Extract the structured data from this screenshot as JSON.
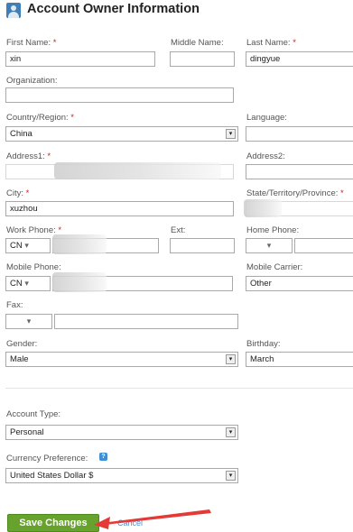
{
  "header": {
    "title": "Account Owner Information",
    "icon": "user-icon"
  },
  "fields": {
    "first_name": {
      "label": "First Name:",
      "required": "*",
      "value": "xin"
    },
    "middle_name": {
      "label": "Middle Name:",
      "value": ""
    },
    "last_name": {
      "label": "Last Name:",
      "required": "*",
      "value": "dingyue"
    },
    "organization": {
      "label": "Organization:",
      "value": ""
    },
    "country": {
      "label": "Country/Region:",
      "required": "*",
      "value": "China"
    },
    "language": {
      "label": "Language:",
      "value": ""
    },
    "address1": {
      "label": "Address1:",
      "required": "*",
      "value": ""
    },
    "address2": {
      "label": "Address2:",
      "value": ""
    },
    "city": {
      "label": "City:",
      "required": "*",
      "value": "xuzhou"
    },
    "state": {
      "label": "State/Territory/Province:",
      "required": "*",
      "value": ""
    },
    "work_phone": {
      "label": "Work Phone:",
      "required": "*",
      "country_code": "CN",
      "value": ""
    },
    "ext": {
      "label": "Ext:",
      "value": ""
    },
    "home_phone": {
      "label": "Home Phone:",
      "country_code": "",
      "value": ""
    },
    "mobile_phone": {
      "label": "Mobile Phone:",
      "country_code": "CN",
      "value": ""
    },
    "mobile_carrier": {
      "label": "Mobile Carrier:",
      "value": "Other"
    },
    "fax": {
      "label": "Fax:",
      "country_code": "",
      "value": ""
    },
    "gender": {
      "label": "Gender:",
      "value": "Male"
    },
    "birthday": {
      "label": "Birthday:",
      "value": "March"
    },
    "account_type": {
      "label": "Account Type:",
      "value": "Personal"
    },
    "currency": {
      "label": "Currency Preference:",
      "value": "United States Dollar $"
    }
  },
  "dropdown_glyph": "▾",
  "actions": {
    "save_label": "Save Changes",
    "cancel_label": "Cancel"
  },
  "colors": {
    "save_button": "#67a22e",
    "required_mark": "#cc2222",
    "annotation_arrow": "#e53935"
  }
}
